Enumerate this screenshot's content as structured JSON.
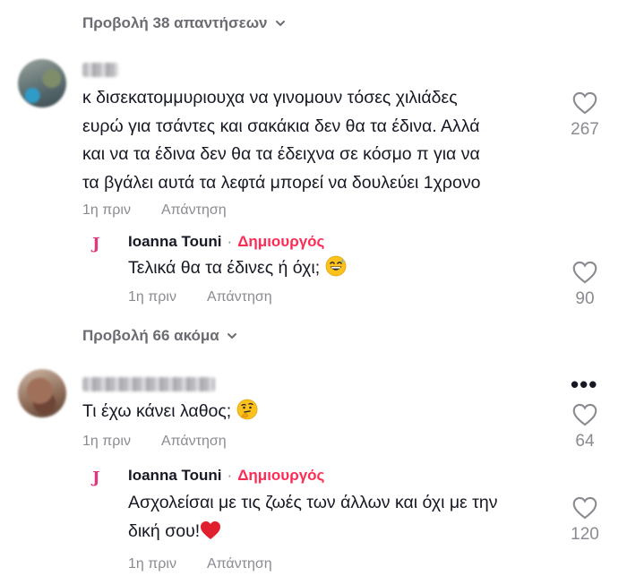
{
  "thread": {
    "view_replies_top": "Προβολή 38 απαντήσεων",
    "view_more_middle": "Προβολή 66 ακόμα"
  },
  "comments": [
    {
      "text_lines": [
        "κ δισεκατομμυριουχα να γινομουν τόσες χιλιάδες",
        "ευρώ για τσάντες και σακάκια δεν θα τα έδινα. Αλλά",
        "και να τα έδινα δεν θα τα έδειχνα σε κόσμο π για να",
        "τα βγάλει αυτά τα λεφτά μπορεί να δουλεύει 1χρονο"
      ],
      "time": "1η πριν",
      "reply_label": "Απάντηση",
      "likes": "267"
    },
    {
      "author": "Ioanna Touni",
      "separator": "·",
      "badge": "Δημιουργός",
      "logo_letter": "J",
      "text": "Τελικά θα τα έδινες ή όχι;",
      "emoji": "grinning-sweat",
      "time": "1η πριν",
      "reply_label": "Απάντηση",
      "likes": "90"
    },
    {
      "text": "Τι έχω κάνει λαθος;",
      "emoji": "thinking-face",
      "time": "1η πριν",
      "reply_label": "Απάντηση",
      "likes": "64",
      "more_icon": "•••"
    },
    {
      "author": "Ioanna Touni",
      "separator": "·",
      "badge": "Δημιουργός",
      "logo_letter": "J",
      "text_lines": [
        "Ασχολείσαι με τις ζωές των άλλων και όχι με την",
        "δική σου!"
      ],
      "emoji": "red-heart",
      "time": "1η πριν",
      "reply_label": "Απάντηση",
      "likes": "120"
    }
  ],
  "colors": {
    "text": "#161823",
    "muted": "#8a8b91",
    "creator_badge": "#fe2c55",
    "logo": "#e0387f"
  }
}
